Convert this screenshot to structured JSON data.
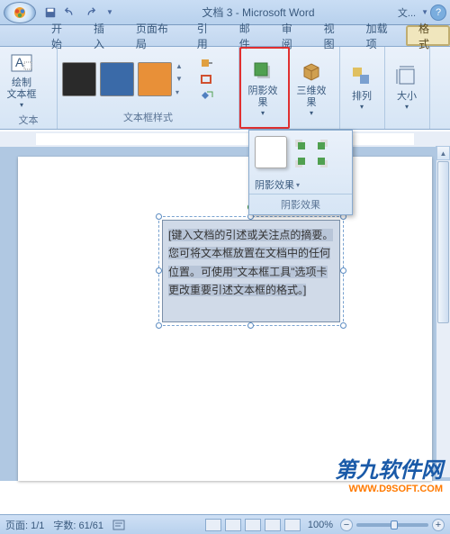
{
  "title": "文档 3 - Microsoft Word",
  "title_right": "文...",
  "tabs": {
    "home": "开始",
    "insert": "插入",
    "layout": "页面布局",
    "ref": "引用",
    "mail": "邮件",
    "review": "审阅",
    "view": "视图",
    "addins": "加载项",
    "format": "格式"
  },
  "ribbon": {
    "textbox_group": "文本",
    "textbox_btn_l1": "绘制",
    "textbox_btn_l2": "文本框",
    "styles_group": "文本框样式",
    "shadow": "阴影效果",
    "threed": "三维效果",
    "arrange": "排列",
    "size": "大小",
    "colors": {
      "c1": "#2a2a2a",
      "c2": "#3a6aa8",
      "c3": "#e89038"
    }
  },
  "dropdown": {
    "label": "阴影效果",
    "footer": "阴影效果"
  },
  "textbox_content": "[键入文档的引述或关注点的摘要。您可将文本框放置在文档中的任何位置。可使用\"文本框工具\"选项卡更改重要引述文本框的格式。]",
  "statusbar": {
    "page": "页面: 1/1",
    "words": "字数: 61/61",
    "zoom": "100%"
  },
  "watermark": {
    "line1": "第九软件网",
    "line2": "WWW.D9SOFT.COM"
  }
}
